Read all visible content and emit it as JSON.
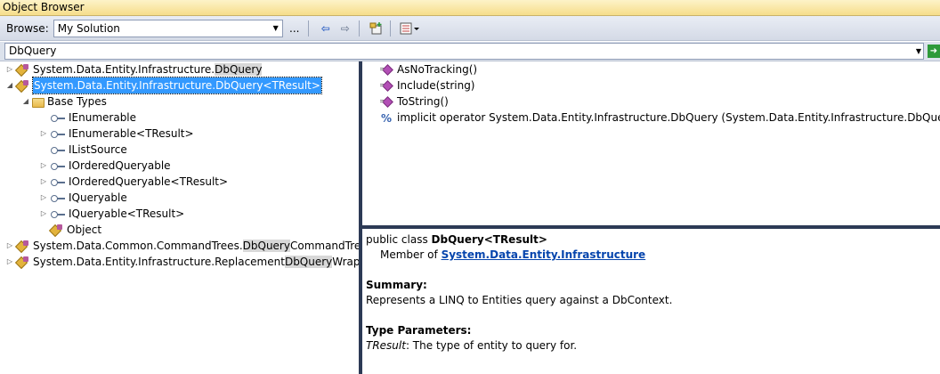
{
  "window": {
    "title": "Object Browser"
  },
  "toolbar": {
    "browse_label": "Browse:",
    "browse_value": "My Solution",
    "customize_label": "..."
  },
  "search": {
    "value": "DbQuery"
  },
  "tree": {
    "rows": [
      {
        "prefix": "System.Data.Entity.Infrastructure.",
        "match": "DbQuery",
        "suffix": ""
      },
      {
        "text": "System.Data.Entity.Infrastructure.DbQuery<TResult>"
      },
      {
        "text": "Base Types"
      },
      {
        "text": "IEnumerable"
      },
      {
        "text": "IEnumerable<TResult>"
      },
      {
        "text": "IListSource"
      },
      {
        "text": "IOrderedQueryable"
      },
      {
        "text": "IOrderedQueryable<TResult>"
      },
      {
        "text": "IQueryable"
      },
      {
        "text": "IQueryable<TResult>"
      },
      {
        "text": "Object"
      },
      {
        "prefix": "System.Data.Common.CommandTrees.",
        "match": "DbQuery",
        "suffix": "CommandTree"
      },
      {
        "prefix": "System.Data.Entity.Infrastructure.Replacement",
        "match": "DbQuery",
        "suffix": "Wrapper<TEle"
      }
    ]
  },
  "members": [
    {
      "text": "AsNoTracking()"
    },
    {
      "text": "Include(string)"
    },
    {
      "text": "ToString()"
    },
    {
      "text": "implicit operator System.Data.Entity.Infrastructure.DbQuery (System.Data.Entity.Infrastructure.DbQuery<TResult>)"
    }
  ],
  "description": {
    "decl_prefix": "public class ",
    "decl_name": "DbQuery<TResult>",
    "member_of_label": "Member of ",
    "member_of_link": "System.Data.Entity.Infrastructure",
    "summary_label": "Summary:",
    "summary_text": "Represents a LINQ to Entities query against a DbContext.",
    "type_params_label": "Type Parameters:",
    "type_param_name": "TResult",
    "type_param_text": ": The type of entity to query for."
  }
}
